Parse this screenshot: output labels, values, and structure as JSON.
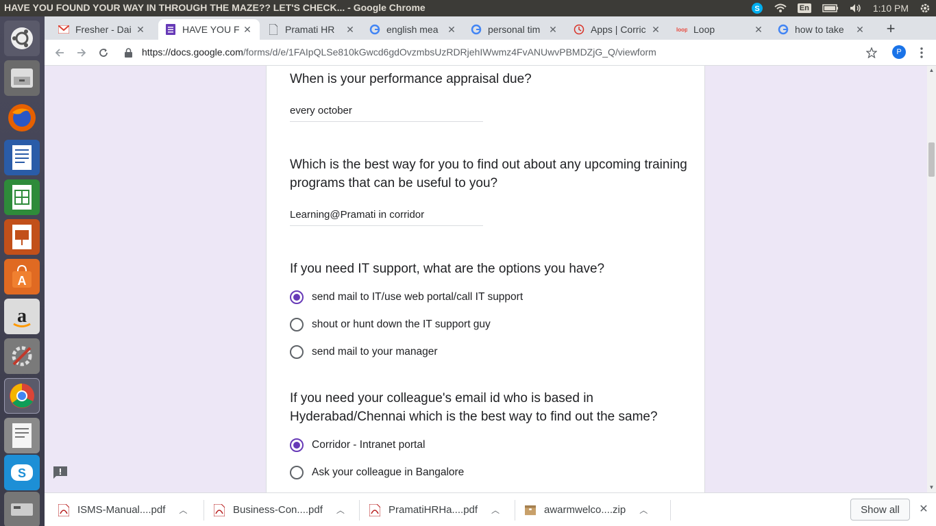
{
  "window": {
    "title": "HAVE YOU FOUND YOUR WAY IN THROUGH THE MAZE?? LET'S CHECK... - Google Chrome"
  },
  "tray": {
    "language": "En",
    "time": "1:10 PM"
  },
  "tabs": [
    {
      "label": "Fresher - Dai",
      "icon": "gmail-icon"
    },
    {
      "label": "HAVE YOU F",
      "icon": "forms-icon",
      "active": true
    },
    {
      "label": "Pramati HR",
      "icon": "doc-icon"
    },
    {
      "label": "english mea",
      "icon": "google-icon"
    },
    {
      "label": "personal tim",
      "icon": "google-icon"
    },
    {
      "label": "Apps | Corric",
      "icon": "apps-icon"
    },
    {
      "label": "Loop",
      "icon": "loop-icon"
    },
    {
      "label": "how to take",
      "icon": "google-icon"
    }
  ],
  "toolbar": {
    "url_host": "https://docs.google.com",
    "url_path": "/forms/d/e/1FAIpQLSe810kGwcd6gdOvzmbsUzRDRjehIWwmz4FvANUwvPBMDZjG_Q/viewform",
    "avatar_letter": "P"
  },
  "form": {
    "q1": {
      "title": "When is your performance appraisal due?",
      "answer": "every october"
    },
    "q2": {
      "title": "Which is the best way for you to find out about any upcoming training programs that can be useful to you?",
      "answer": "Learning@Pramati in corridor"
    },
    "q3": {
      "title": "If you need IT support, what are the options you have?",
      "options": [
        {
          "label": "send mail to IT/use web portal/call IT support",
          "selected": true
        },
        {
          "label": "shout or hunt down the IT support guy",
          "selected": false
        },
        {
          "label": "send mail to your manager",
          "selected": false
        }
      ]
    },
    "q4": {
      "title": "If you need your colleague's email id who is based in Hyderabad/Chennai which is the best way to find out the same?",
      "options": [
        {
          "label": "Corridor - Intranet portal",
          "selected": true
        },
        {
          "label": "Ask your colleague in Bangalore",
          "selected": false
        }
      ]
    }
  },
  "downloads": {
    "items": [
      {
        "name": "ISMS-Manual....pdf",
        "type": "pdf"
      },
      {
        "name": "Business-Con....pdf",
        "type": "pdf"
      },
      {
        "name": "PramatiHRHa....pdf",
        "type": "pdf"
      },
      {
        "name": "awarmwelco....zip",
        "type": "zip"
      }
    ],
    "show_all": "Show all"
  },
  "colors": {
    "accent": "#673ab7",
    "page_bg": "#ede7f6"
  }
}
